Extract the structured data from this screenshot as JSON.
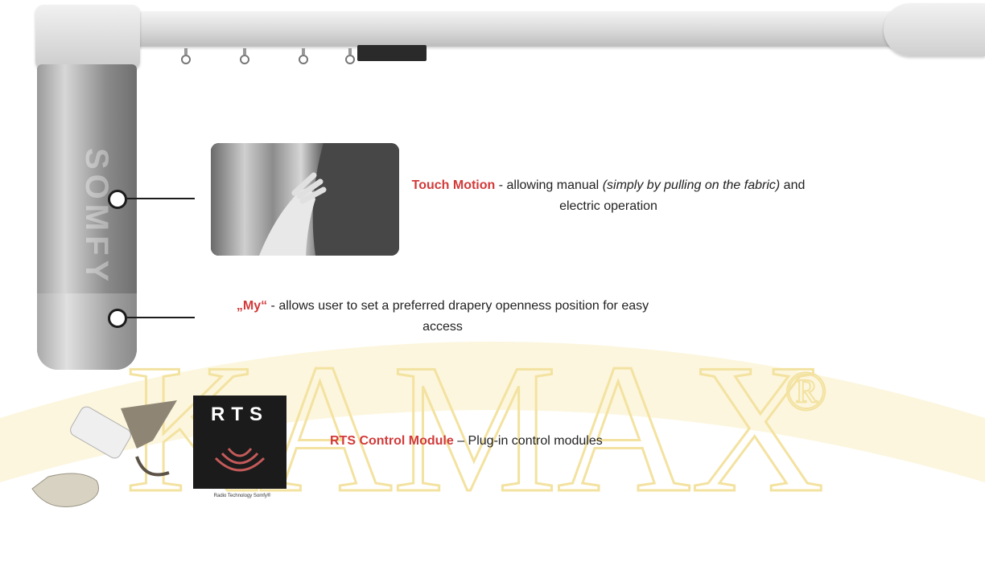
{
  "watermark": {
    "text": "KAMAX",
    "mark": "®",
    "color": "#f7e7a8"
  },
  "product": {
    "brand_text": "SOMFY"
  },
  "callouts": {
    "touch_motion": {
      "title": "Touch Motion",
      "sep": " - allowing manual ",
      "italic": "(simply by pulling on the fabric)",
      "rest": " and electric operation"
    },
    "my": {
      "title": "„My“",
      "rest": " - allows user to set a preferred drapery openness position for easy access"
    },
    "rts": {
      "title": "RTS Control Module",
      "rest": "  – Plug-in control modules",
      "logo_letters": "RTS",
      "logo_sub": "Radio Technology Somfy®"
    }
  },
  "colors": {
    "accent": "#d23a3a",
    "text": "#222222"
  }
}
